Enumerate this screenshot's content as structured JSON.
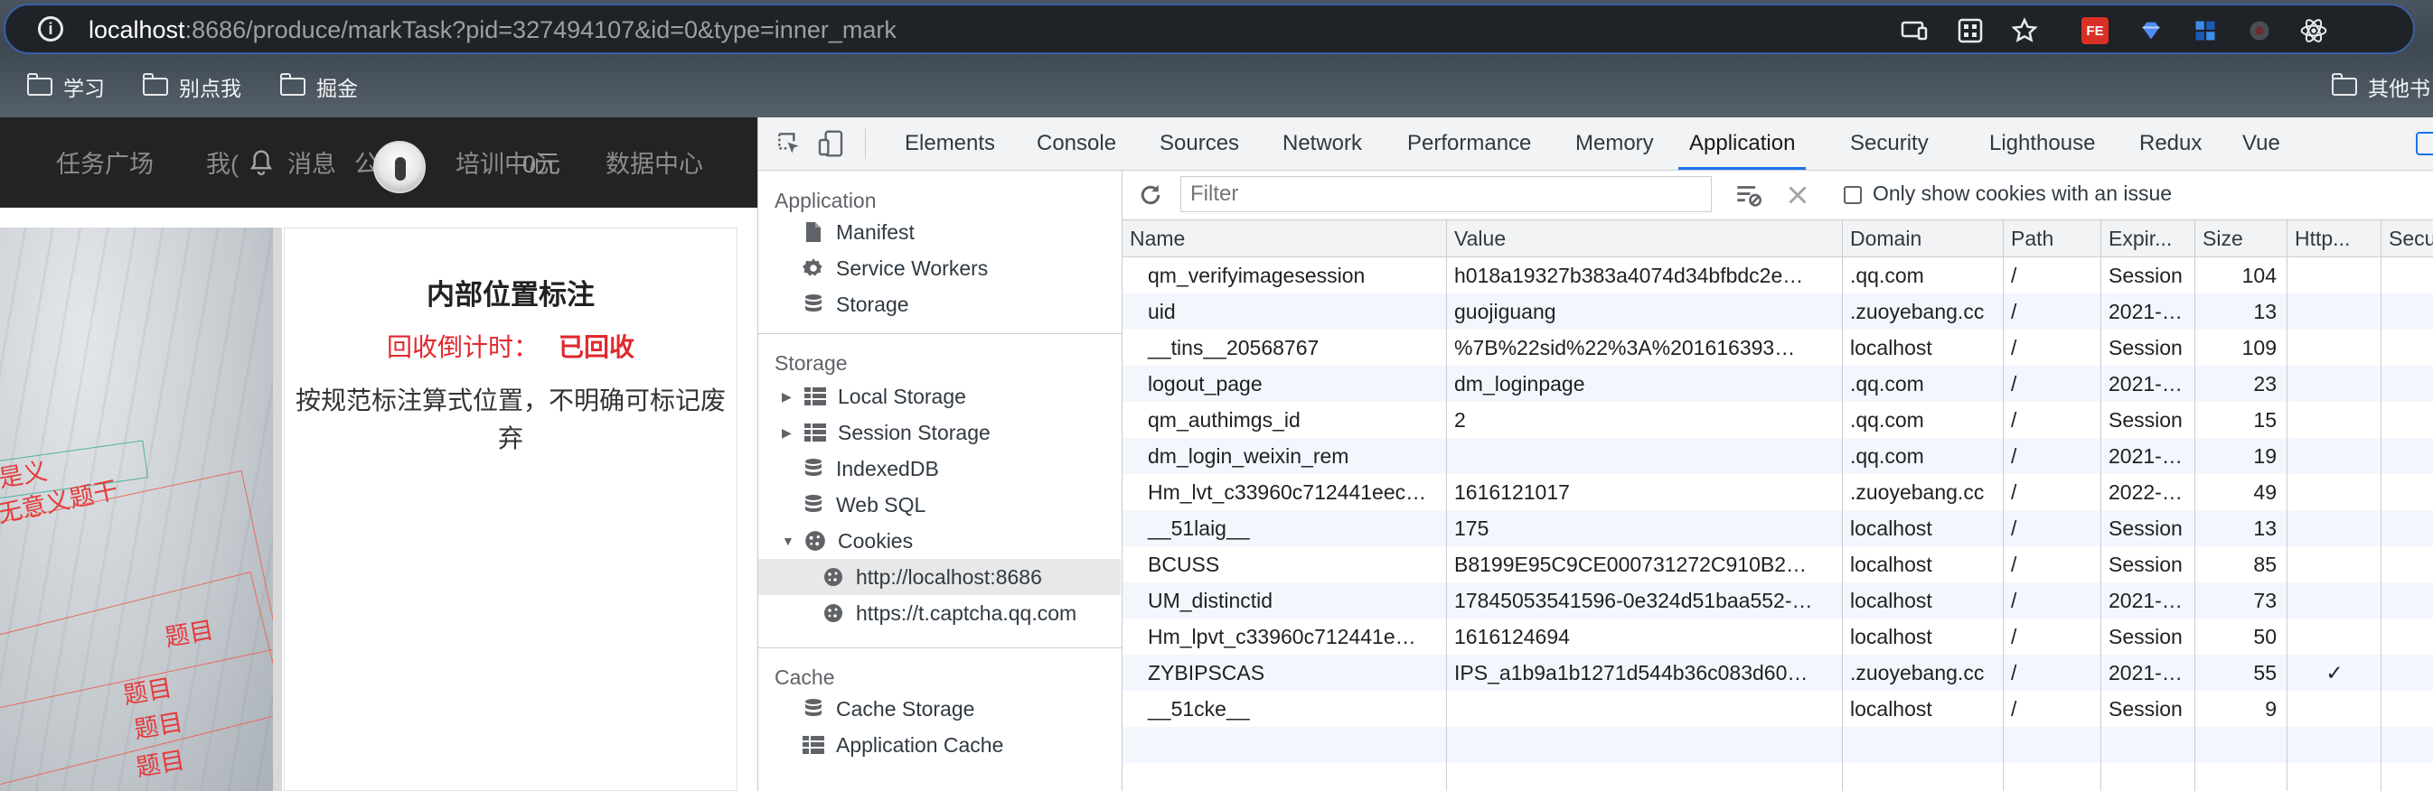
{
  "browser": {
    "url_host": "localhost",
    "url_rest": ":8686/produce/markTask?pid=327494107&id=0&type=inner_mark",
    "bookmarks": [
      "学习",
      "别点我",
      "掘金",
      "其他书"
    ]
  },
  "page": {
    "nav": {
      "items": [
        "任务广场",
        "我(",
        "消息",
        "公(",
        "培训中心",
        "数据中心"
      ],
      "notification_badge_text": "0元"
    },
    "photo_marks": [
      "是义",
      "无意义题干",
      "题目",
      "题目",
      "题目",
      "题目"
    ],
    "panel": {
      "title": "内部位置标注",
      "countdown_label": "回收倒计时：",
      "countdown_value": "已回收",
      "description": "按规范标注算式位置，不明确可标记废弃"
    }
  },
  "devtools": {
    "tabs": [
      "Elements",
      "Console",
      "Sources",
      "Network",
      "Performance",
      "Memory",
      "Application",
      "Security",
      "Lighthouse",
      "Redux",
      "Vue"
    ],
    "active_tab": "Application",
    "sidebar": {
      "application_header": "Application",
      "application_items": [
        "Manifest",
        "Service Workers",
        "Storage"
      ],
      "storage_header": "Storage",
      "storage_items": [
        "Local Storage",
        "Session Storage",
        "IndexedDB",
        "Web SQL",
        "Cookies"
      ],
      "cookie_origins": [
        "http://localhost:8686",
        "https://t.captcha.qq.com"
      ],
      "cache_header": "Cache",
      "cache_items": [
        "Cache Storage",
        "Application Cache"
      ]
    },
    "filter": {
      "placeholder": "Filter",
      "only_issues_label": "Only show cookies with an issue"
    },
    "table": {
      "columns": [
        "Name",
        "Value",
        "Domain",
        "Path",
        "Expir...",
        "Size",
        "Http...",
        "Secu"
      ],
      "rows": [
        [
          "qm_verifyimagesession",
          "h018a19327b383a4074d34bfbdc2e…",
          ".qq.com",
          "/",
          "Session",
          "104",
          ""
        ],
        [
          "uid",
          "guojiguang",
          ".zuoyebang.cc",
          "/",
          "2021-…",
          "13",
          ""
        ],
        [
          "__tins__20568767",
          "%7B%22sid%22%3A%201616393…",
          "localhost",
          "/",
          "Session",
          "109",
          ""
        ],
        [
          "logout_page",
          "dm_loginpage",
          ".qq.com",
          "/",
          "2021-…",
          "23",
          ""
        ],
        [
          "qm_authimgs_id",
          "2",
          ".qq.com",
          "/",
          "Session",
          "15",
          ""
        ],
        [
          "dm_login_weixin_rem",
          "",
          ".qq.com",
          "/",
          "2021-…",
          "19",
          ""
        ],
        [
          "Hm_lvt_c33960c712441eec…",
          "1616121017",
          ".zuoyebang.cc",
          "/",
          "2022-…",
          "49",
          ""
        ],
        [
          "__51laig__",
          "175",
          "localhost",
          "/",
          "Session",
          "13",
          ""
        ],
        [
          "BCUSS",
          "B8199E95C9CE000731272C910B2…",
          "localhost",
          "/",
          "Session",
          "85",
          ""
        ],
        [
          "UM_distinctid",
          "17845053541596-0e324d51baa552-…",
          "localhost",
          "/",
          "2021-…",
          "73",
          ""
        ],
        [
          "Hm_lpvt_c33960c712441e…",
          "1616124694",
          "localhost",
          "/",
          "Session",
          "50",
          ""
        ],
        [
          "ZYBIPSCAS",
          "IPS_a1b9a1b1271d544b36c083d60…",
          ".zuoyebang.cc",
          "/",
          "2021-…",
          "55",
          "✓"
        ],
        [
          "__51cke__",
          "",
          "localhost",
          "/",
          "Session",
          "9",
          ""
        ]
      ]
    }
  }
}
